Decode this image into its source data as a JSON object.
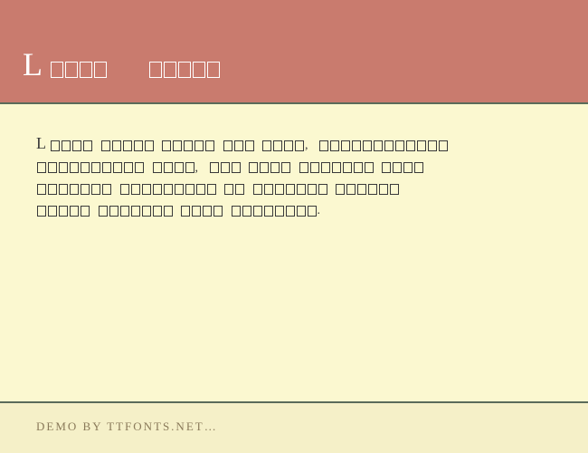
{
  "header": {
    "title_prefix": "L",
    "title_boxes_1": 4,
    "title_boxes_2": 5
  },
  "content": {
    "line1_prefix": "L",
    "words": [
      [
        4
      ],
      [
        5
      ],
      [
        5
      ],
      [
        3
      ],
      [
        4
      ],
      [
        "comma"
      ],
      [
        12
      ],
      [
        "break"
      ],
      [
        10
      ],
      [
        4
      ],
      [
        "comma"
      ],
      [
        3
      ],
      [
        4
      ],
      [
        7
      ],
      [
        4
      ],
      [
        "break"
      ],
      [
        7
      ],
      [
        9
      ],
      [
        2
      ],
      [
        7
      ],
      [
        6
      ],
      [
        "break"
      ],
      [
        5
      ],
      [
        7
      ],
      [
        4
      ],
      [
        8
      ],
      [
        "period"
      ]
    ]
  },
  "footer": {
    "text": "DEMO BY TTFONTS.NET…"
  }
}
